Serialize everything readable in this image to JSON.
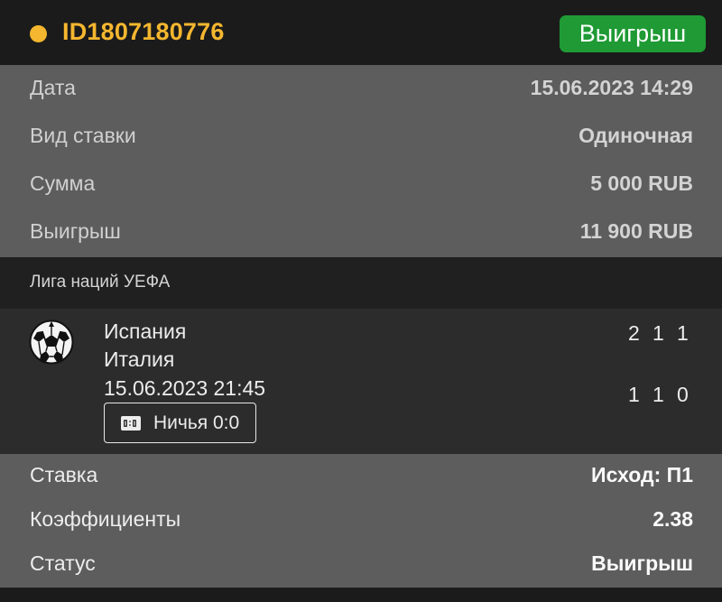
{
  "header": {
    "bet_id": "ID1807180776",
    "status_button": "Выигрыш",
    "accent_color": "#f5b72f",
    "status_color": "#1f9a34"
  },
  "info": {
    "rows": [
      {
        "label": "Дата",
        "value": "15.06.2023 14:29"
      },
      {
        "label": "Вид ставки",
        "value": "Одиночная"
      },
      {
        "label": "Сумма",
        "value": "5 000 RUB"
      },
      {
        "label": "Выигрыш",
        "value": "11 900 RUB"
      }
    ]
  },
  "league": {
    "name": "Лига наций УЕФА"
  },
  "match": {
    "icon": "soccer-ball-icon",
    "team1": "Испания",
    "team2": "Италия",
    "datetime": "15.06.2023 21:45",
    "score_row1": [
      "2",
      "1",
      "1"
    ],
    "score_row2": [
      "1",
      "1",
      "0"
    ],
    "badge": {
      "icon": "scoreboard-icon",
      "label": "Ничья 0:0"
    }
  },
  "bet": {
    "rows": [
      {
        "label": "Ставка",
        "value": "Исход: П1"
      },
      {
        "label": "Коэффициенты",
        "value": "2.38"
      },
      {
        "label": "Статус",
        "value": "Выигрыш"
      }
    ]
  }
}
